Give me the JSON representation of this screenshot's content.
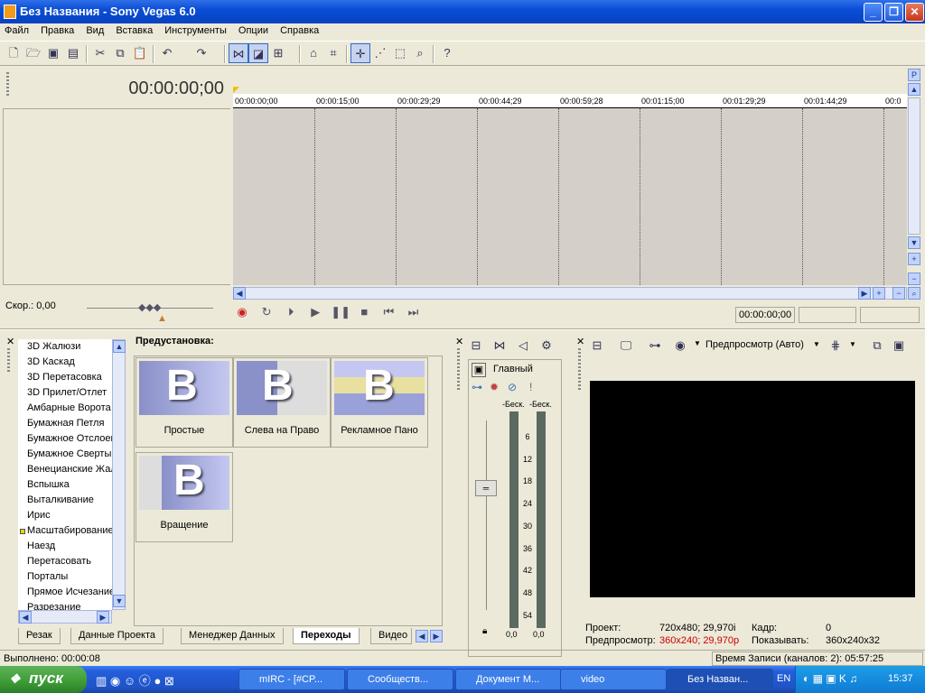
{
  "window": {
    "title": "Без Названия - Sony Vegas 6.0"
  },
  "menu": [
    "Файл",
    "Правка",
    "Вид",
    "Вставка",
    "Инструменты",
    "Опции",
    "Справка"
  ],
  "timecode_main": "00:00:00;00",
  "ruler_marks": [
    "00:00:00;00",
    "00:00:15;00",
    "00:00:29;29",
    "00:00:44;29",
    "00:00:59;28",
    "00:01:15;00",
    "00:01:29;29",
    "00:01:44;29",
    "00:0"
  ],
  "speed_label": "Скор.: 0,00",
  "transport_time": "00:00:00;00",
  "transitions": {
    "list": [
      "3D Жалюзи",
      "3D Каскад",
      "3D Перетасовка",
      "3D Прилет/Отлет",
      "Амбарные Ворота",
      "Бумажная Петля",
      "Бумажное Отслоение",
      "Бумажное Свертывание",
      "Венецианские Жалюзи",
      "Вспышка",
      "Выталкивание",
      "Ирис",
      "Масштабирование",
      "Наезд",
      "Перетасовать",
      "Порталы",
      "Прямое Исчезание",
      "Разрезание"
    ],
    "preset_label": "Предустановка:",
    "presets": [
      "Простые",
      "Слева на Право",
      "Рекламное Пано",
      "Вращение"
    ]
  },
  "tabs": [
    "Резак",
    "Данные Проекта",
    "Менеджер Данных",
    "Переходы",
    "Видео"
  ],
  "mixer": {
    "label": "Главный",
    "inf_left": "-Беск.",
    "inf_right": "-Беск.",
    "scale": [
      "6",
      "12",
      "18",
      "24",
      "30",
      "36",
      "42",
      "48",
      "54"
    ],
    "val_left": "0,0",
    "val_right": "0,0"
  },
  "preview": {
    "mode": "Предпросмотр (Авто)",
    "project_label": "Проект:",
    "project_value": "720x480; 29,970i",
    "preview_label": "Предпросмотр:",
    "preview_value": "360x240; 29,970p",
    "frame_label": "Кадр:",
    "frame_value": "0",
    "display_label": "Показывать:",
    "display_value": "360x240x32",
    "accent": "#cc0000"
  },
  "status": {
    "left": "Выполнено: 00:00:08",
    "right": "Время Записи (каналов: 2): 05:57:25"
  },
  "taskbar": {
    "start": "пуск",
    "tasks": [
      "mIRC - [#CP...",
      "Сообществ...",
      "Документ М...",
      "video",
      "Без Назван..."
    ],
    "lang": "EN",
    "clock": "15:37"
  }
}
